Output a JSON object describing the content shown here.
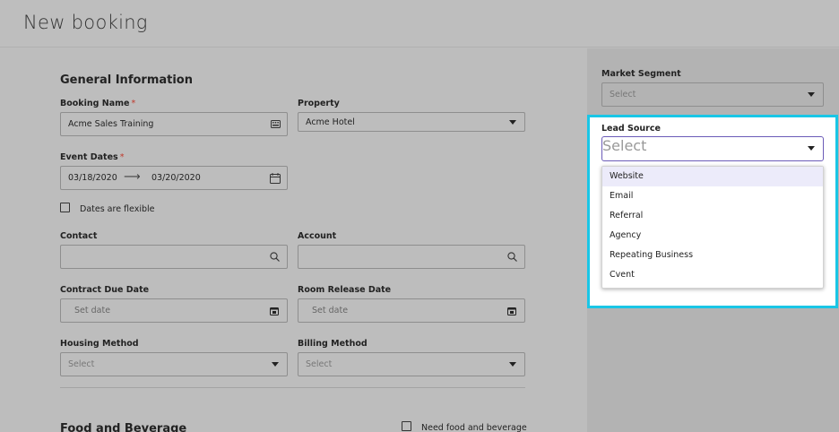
{
  "page": {
    "title": "New booking"
  },
  "general": {
    "section_title": "General Information",
    "booking_name": {
      "label": "Booking Name",
      "required_mark": "*",
      "value": "Acme Sales Training"
    },
    "property": {
      "label": "Property",
      "value": "Acme Hotel"
    },
    "event_dates": {
      "label": "Event Dates",
      "required_mark": "*",
      "start": "03/18/2020",
      "arrow": "⟶",
      "end": "03/20/2020"
    },
    "flexible": {
      "label": "Dates are flexible",
      "checked": false
    },
    "contact": {
      "label": "Contact",
      "value": ""
    },
    "account": {
      "label": "Account",
      "value": ""
    },
    "contract_due": {
      "label": "Contract Due Date",
      "placeholder": "Set date"
    },
    "room_release": {
      "label": "Room Release Date",
      "placeholder": "Set date"
    },
    "housing_method": {
      "label": "Housing Method",
      "placeholder": "Select"
    },
    "billing_method": {
      "label": "Billing Method",
      "placeholder": "Select"
    }
  },
  "food": {
    "section_title": "Food and Beverage",
    "need_label": "Need food and beverage",
    "checked": false
  },
  "side": {
    "market_segment": {
      "label": "Market Segment",
      "placeholder": "Select"
    },
    "lead_source": {
      "label": "Lead Source",
      "placeholder": "Select",
      "options": [
        "Website",
        "Email",
        "Referral",
        "Agency",
        "Repeating Business",
        "Cvent"
      ],
      "highlighted_option": "Website"
    }
  },
  "colors": {
    "highlight_border": "#19c6e6",
    "focus_border": "#6b5bb8",
    "required": "#c0392b"
  },
  "icons": [
    "keyboard-icon",
    "calendar-icon",
    "search-icon",
    "chevron-down-icon",
    "arrow-right-icon"
  ]
}
